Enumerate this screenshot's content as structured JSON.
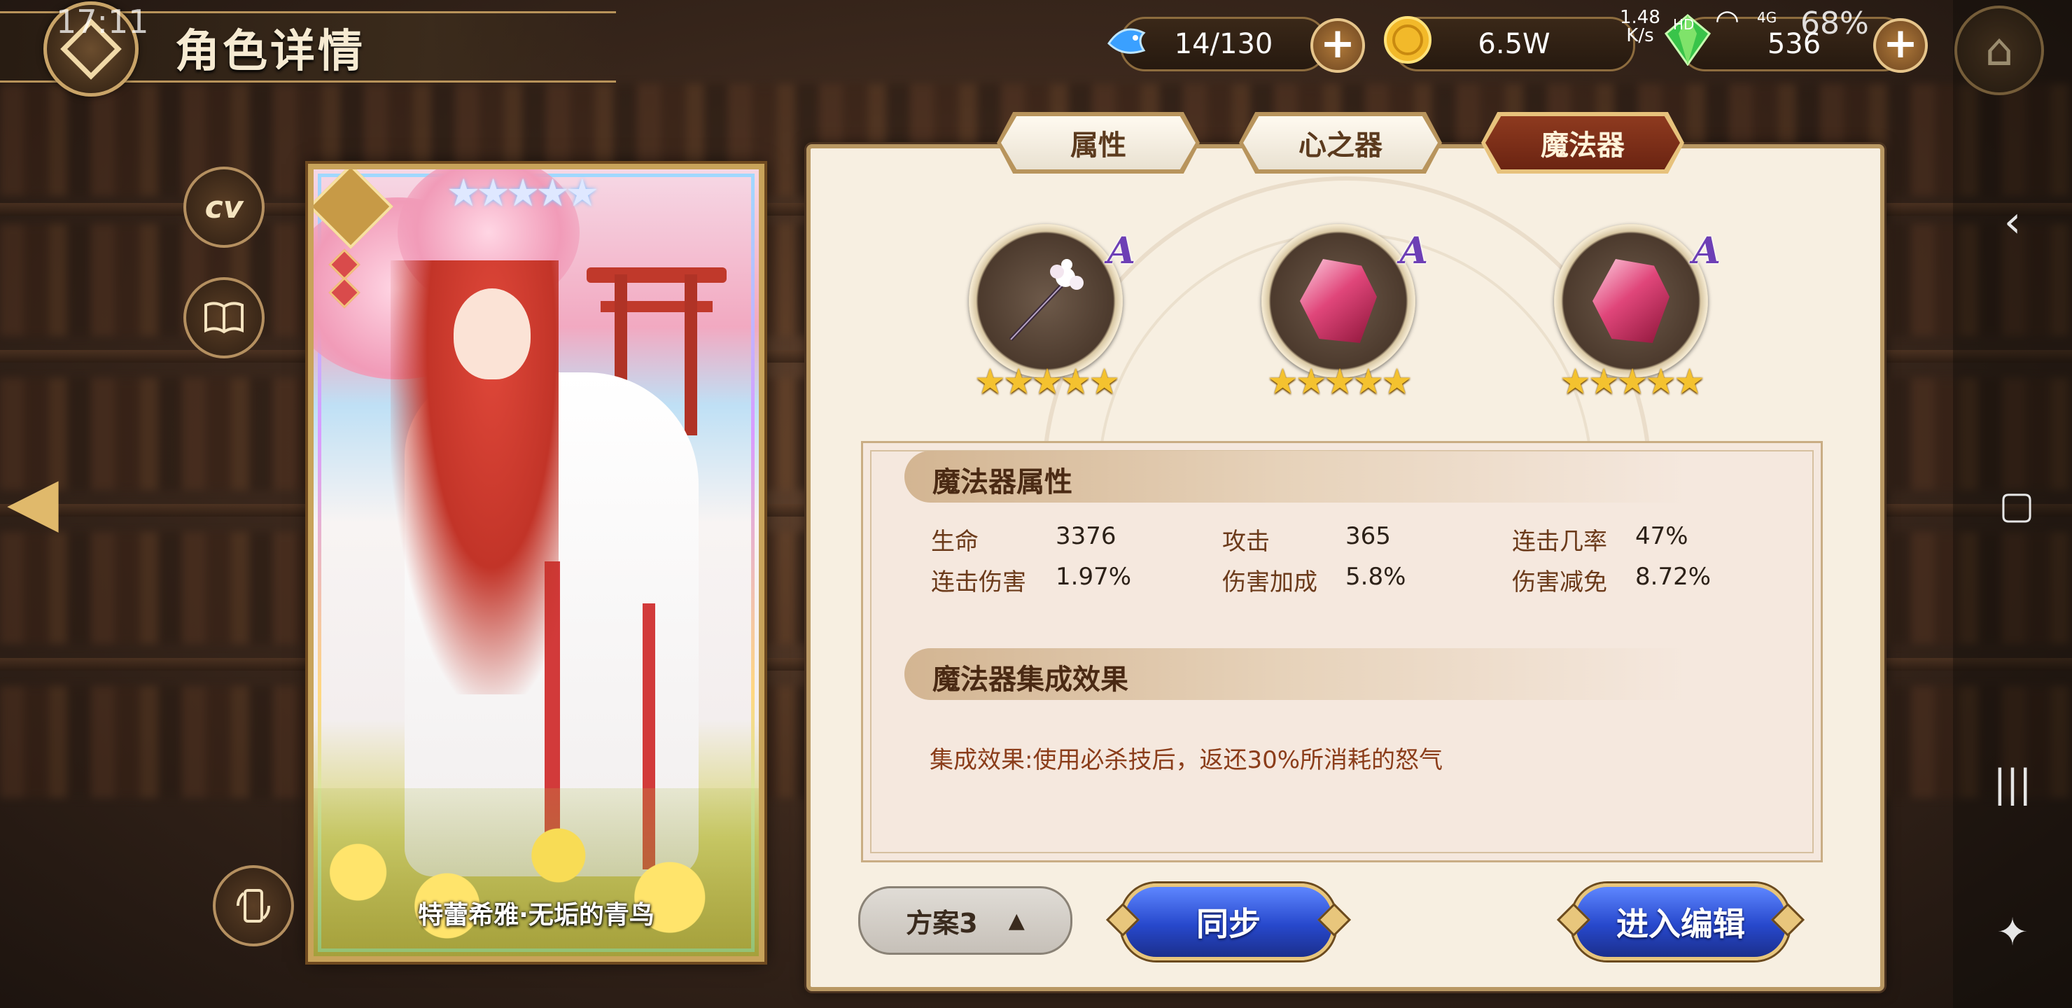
{
  "status_bar": {
    "time": "17:11",
    "net_speed_value": "1.48",
    "net_speed_unit": "K/s",
    "hd": "HD",
    "network": "4G",
    "battery": "68%"
  },
  "header": {
    "title": "角色详情"
  },
  "resources": {
    "stamina": "14/130",
    "gold": "6.5W",
    "gems": "536"
  },
  "side_buttons": {
    "cv_label": "cv"
  },
  "card": {
    "name": "特蕾希雅·无垢的青鸟",
    "stars": "★★★★★",
    "star_count": 5
  },
  "tabs": [
    {
      "label": "属性",
      "active": false
    },
    {
      "label": "心之器",
      "active": false
    },
    {
      "label": "魔法器",
      "active": true
    }
  ],
  "equipment": [
    {
      "grade": "A",
      "stars": "★★★★★",
      "star_count": 5,
      "icon": "staff-icon"
    },
    {
      "grade": "A",
      "stars": "★★★★★",
      "star_count": 5,
      "icon": "crystal-icon"
    },
    {
      "grade": "A",
      "stars": "★★★★★",
      "star_count": 5,
      "icon": "crystal-icon"
    }
  ],
  "attributes": {
    "title": "魔法器属性",
    "stats": [
      {
        "label": "生命",
        "value": "3376"
      },
      {
        "label": "攻击",
        "value": "365"
      },
      {
        "label": "连击几率",
        "value": "47%"
      },
      {
        "label": "连击伤害",
        "value": "1.97%"
      },
      {
        "label": "伤害加成",
        "value": "5.8%"
      },
      {
        "label": "伤害减免",
        "value": "8.72%"
      }
    ]
  },
  "set_effect": {
    "title": "魔法器集成效果",
    "text": "集成效果:使用必杀技后，返还30%所消耗的怒气"
  },
  "footer": {
    "scheme_label": "方案3",
    "scheme_arrow": "▲",
    "sync_label": "同步",
    "edit_label": "进入编辑"
  },
  "colors": {
    "active_tab": "#7a2e18",
    "button_blue": "#2748cc",
    "star_gold": "#f4c22f",
    "grade_purple": "#6d3fb5"
  }
}
